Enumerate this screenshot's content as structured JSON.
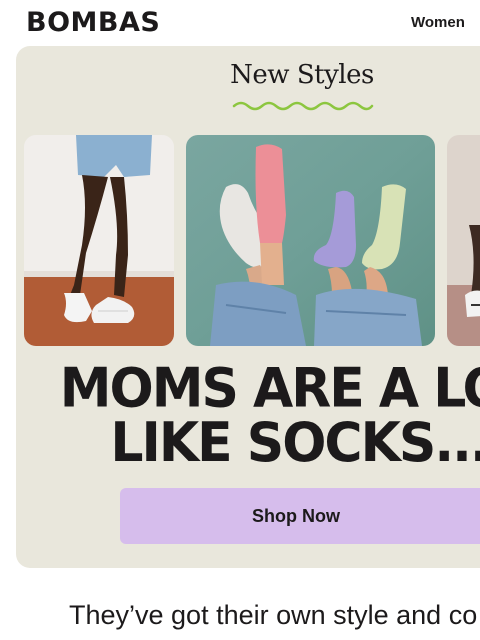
{
  "header": {
    "logo_text": "BOMBAS",
    "nav_item": "Women"
  },
  "hero": {
    "eyebrow": "New Styles",
    "headline_line1": "MOMS ARE A LOT",
    "headline_line2": "LIKE SOCKS...",
    "cta_label": "Shop Now",
    "accent_squiggle_color": "#8cc63f",
    "cta_color": "#d6bdec",
    "background_color": "#e9e7dc"
  },
  "body": {
    "subcopy": "They’ve got their own style and co"
  }
}
